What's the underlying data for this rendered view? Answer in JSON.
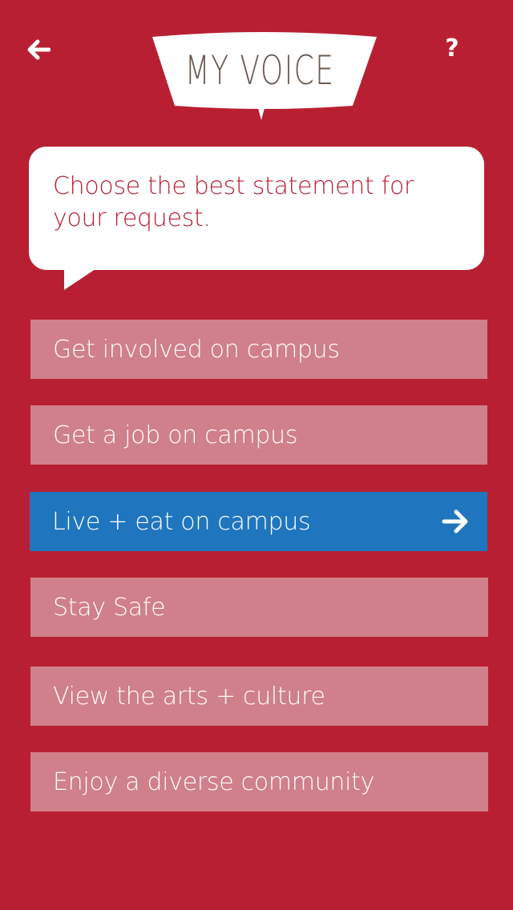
{
  "header": {
    "logo_text": "MY VOICE",
    "back_icon": "arrow-left-icon",
    "help_label": "?"
  },
  "prompt": {
    "text": "Choose the best statement for your request."
  },
  "options": [
    {
      "label": "Get involved on campus",
      "selected": false
    },
    {
      "label": "Get a job on campus",
      "selected": false
    },
    {
      "label": "Live + eat on campus",
      "selected": true,
      "icon": "arrow-right-icon"
    },
    {
      "label": "Stay Safe",
      "selected": false
    },
    {
      "label": "View the arts + culture",
      "selected": false
    },
    {
      "label": "Enjoy a diverse community",
      "selected": false
    }
  ],
  "colors": {
    "background": "#b91f32",
    "option": "#d0808a",
    "selected_option": "#1f75be",
    "logo_text": "#6b5a50"
  }
}
